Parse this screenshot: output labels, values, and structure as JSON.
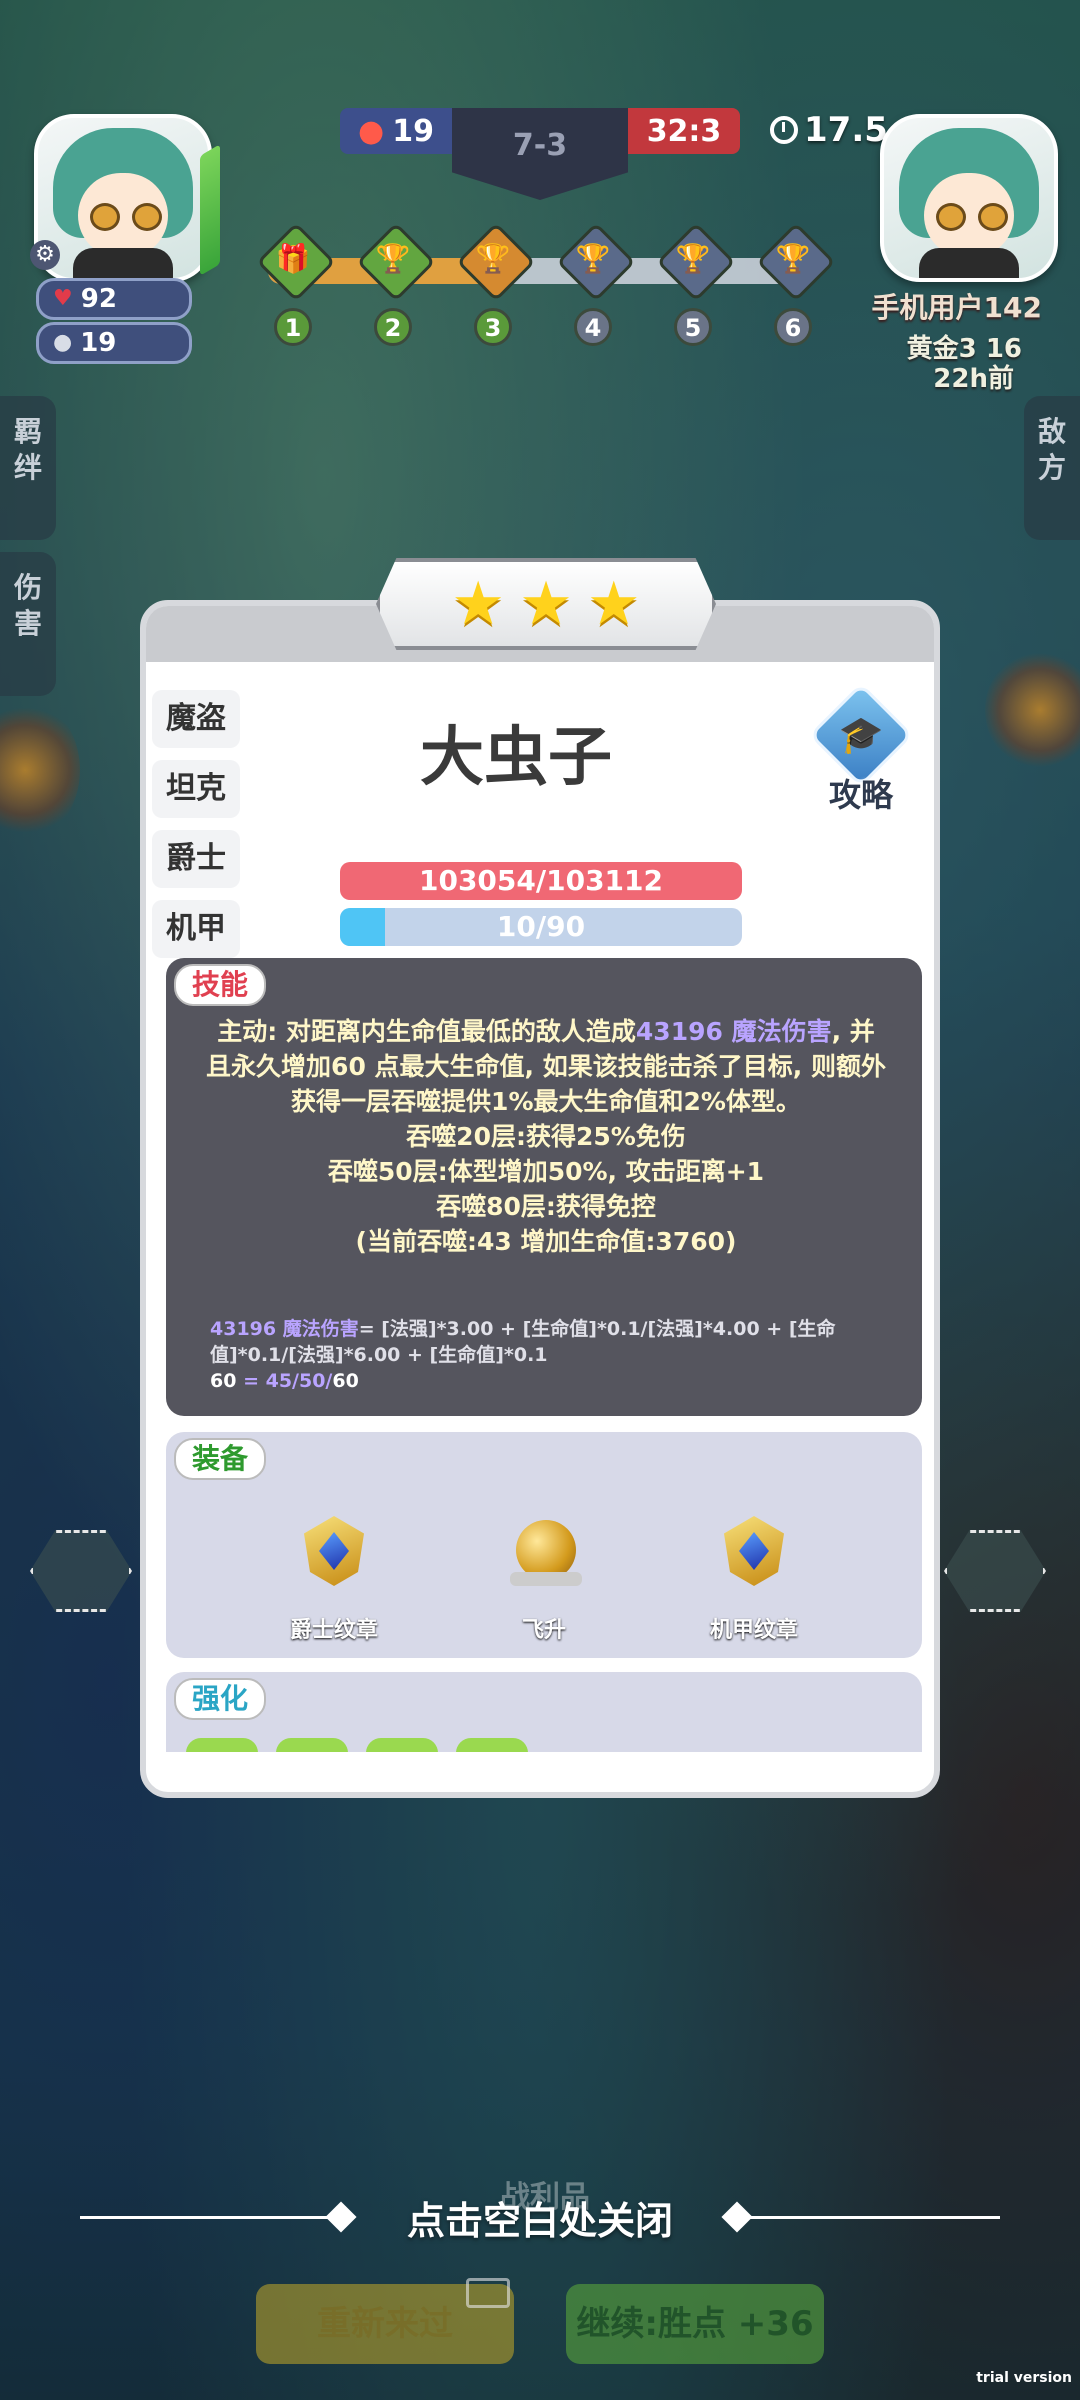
{
  "hud": {
    "player": {
      "hp": "92",
      "coins": "19"
    },
    "score": {
      "left": "19",
      "stage": "7-3",
      "right": "32:3"
    },
    "timer": "17.5",
    "stages": [
      "1",
      "2",
      "3",
      "4",
      "5",
      "6"
    ],
    "opponent": {
      "name": "手机用户142",
      "rank": "黄金3 16",
      "time": "22h前"
    }
  },
  "side_tabs": {
    "left_top": "羁绊",
    "left_bottom": "伤害",
    "right": "敌方"
  },
  "modal": {
    "stars": 3,
    "class_tabs": [
      "魔盗",
      "坦克",
      "爵士",
      "机甲"
    ],
    "hero_name": "大虫子",
    "guide_label": "攻略",
    "hp_text": "103054/103112",
    "hp_fraction": 0.9994,
    "mana_text": "10/90",
    "mana_fraction": 0.111,
    "skill": {
      "label": "技能",
      "line1_prefix": "主动: 对距离内生命值最低的敌人造成",
      "line1_value": "43196 魔法伤害",
      "line1_suffix": ", 并且永久增加60 点最大生命值, 如果该技能击杀了目标, 则额外获得一层吞噬提供1%最大生命值和2%体型。",
      "tier1": "吞噬20层:获得25%免伤",
      "tier2": "吞噬50层:体型增加50%, 攻击距离+1",
      "tier3": "吞噬80层:获得免控",
      "current": "(当前吞噬:43 增加生命值:3760)",
      "formula_value": "43196 魔法伤害",
      "formula_rest": "= [法强]*3.00 + [生命值]*0.1/[法强]*4.00 + [生命值]*0.1/[法强]*6.00 + [生命值]*0.1",
      "formula2_value": "60",
      "formula2_rest": " = 45/50/",
      "formula2_end": "60"
    },
    "equipment": {
      "label": "装备",
      "items": [
        {
          "name": "爵士纹章",
          "color": "#2f9ad6"
        },
        {
          "name": "飞升",
          "color": "#f07a2a"
        },
        {
          "name": "机甲纹章",
          "color": "#2f9ad6"
        }
      ]
    },
    "enhance_label": "强化"
  },
  "footer": {
    "close_hint": "点击空白处关闭",
    "loot_label": "战利品",
    "retry_label": "重新来过",
    "continue_label": "继续:胜点 +36",
    "watermark": "trial version"
  }
}
